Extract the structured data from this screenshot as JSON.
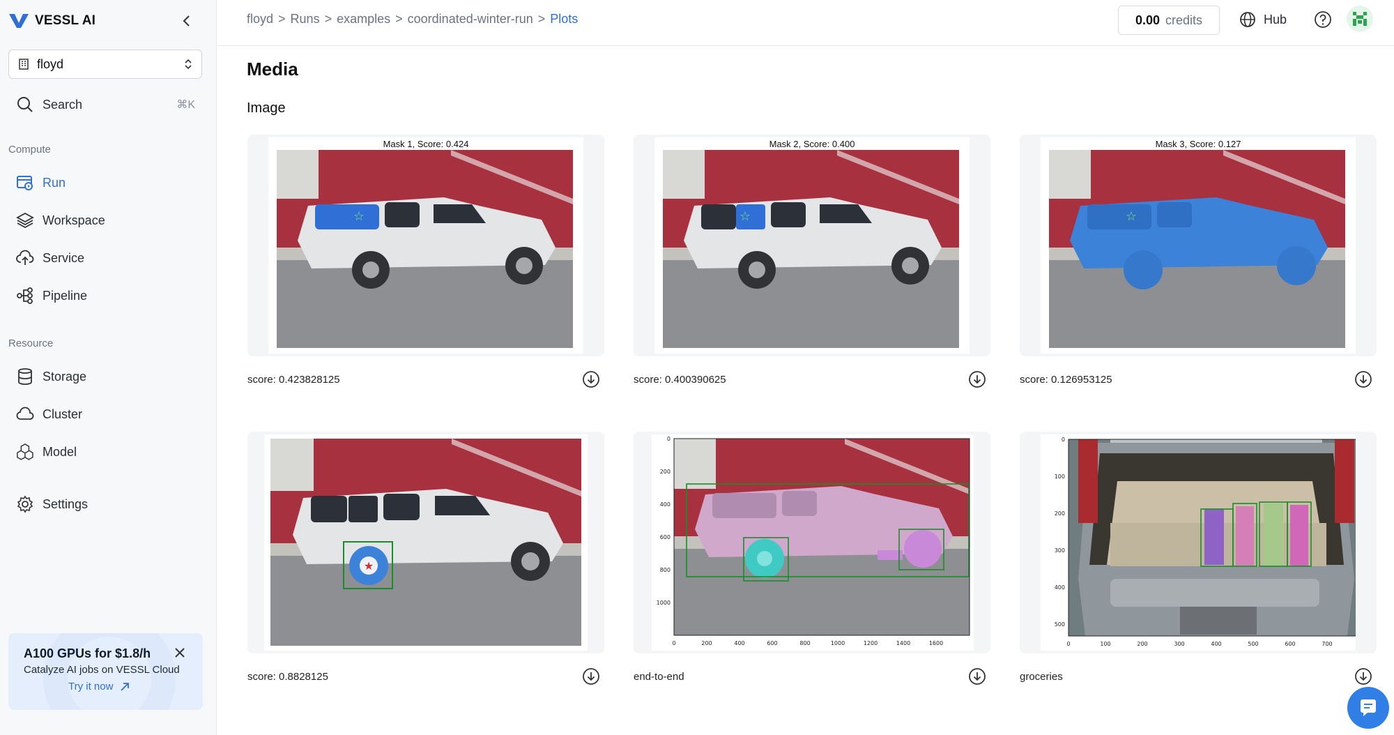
{
  "app": {
    "brand": "VESSL AI"
  },
  "sidebar": {
    "org": "floyd",
    "search": {
      "label": "Search",
      "shortcut": "⌘K"
    },
    "compute_label": "Compute",
    "compute_items": [
      {
        "label": "Run",
        "icon": "run-icon",
        "active": true
      },
      {
        "label": "Workspace",
        "icon": "layers-icon"
      },
      {
        "label": "Service",
        "icon": "cloud-upload-icon"
      },
      {
        "label": "Pipeline",
        "icon": "pipeline-icon"
      }
    ],
    "resource_label": "Resource",
    "resource_items": [
      {
        "label": "Storage",
        "icon": "database-icon"
      },
      {
        "label": "Cluster",
        "icon": "cloud-icon"
      },
      {
        "label": "Model",
        "icon": "model-icon"
      }
    ],
    "settings": "Settings",
    "promo": {
      "title": "A100 GPUs for $1.8/h",
      "subtitle": "Catalyze AI jobs on VESSL Cloud",
      "cta": "Try it now"
    }
  },
  "header": {
    "breadcrumb": [
      "floyd",
      ">",
      "Runs",
      ">",
      "examples",
      ">",
      "coordinated-winter-run",
      ">",
      "Plots"
    ],
    "credits_value": "0.00",
    "credits_unit": "credits",
    "hub": "Hub"
  },
  "main": {
    "section_title": "Media",
    "subsection_title": "Image",
    "cards": [
      {
        "figure_title": "Mask 1, Score: 0.424",
        "caption": "score: 0.423828125",
        "kind": "mask-window"
      },
      {
        "figure_title": "Mask 2, Score: 0.400",
        "caption": "score: 0.400390625",
        "kind": "mask-window2"
      },
      {
        "figure_title": "Mask 3, Score: 0.127",
        "caption": "score: 0.126953125",
        "kind": "mask-full"
      },
      {
        "figure_title": "",
        "caption": "score: 0.8828125",
        "kind": "mask-wheel"
      },
      {
        "figure_title": "",
        "caption": "end-to-end",
        "kind": "segment-plot",
        "x_ticks": [
          "0",
          "200",
          "400",
          "600",
          "800",
          "1000",
          "1200",
          "1400",
          "1600"
        ],
        "y_ticks": [
          "0",
          "200",
          "400",
          "600",
          "800",
          "1000"
        ]
      },
      {
        "figure_title": "",
        "caption": "groceries",
        "kind": "groceries-plot",
        "x_ticks": [
          "0",
          "100",
          "200",
          "300",
          "400",
          "500",
          "600",
          "700"
        ],
        "y_ticks": [
          "0",
          "100",
          "200",
          "300",
          "400",
          "500"
        ]
      }
    ]
  },
  "colors": {
    "accent": "#2f6fd6",
    "mask_blue": "#3b82d8",
    "box_green": "#1a8c2a"
  }
}
